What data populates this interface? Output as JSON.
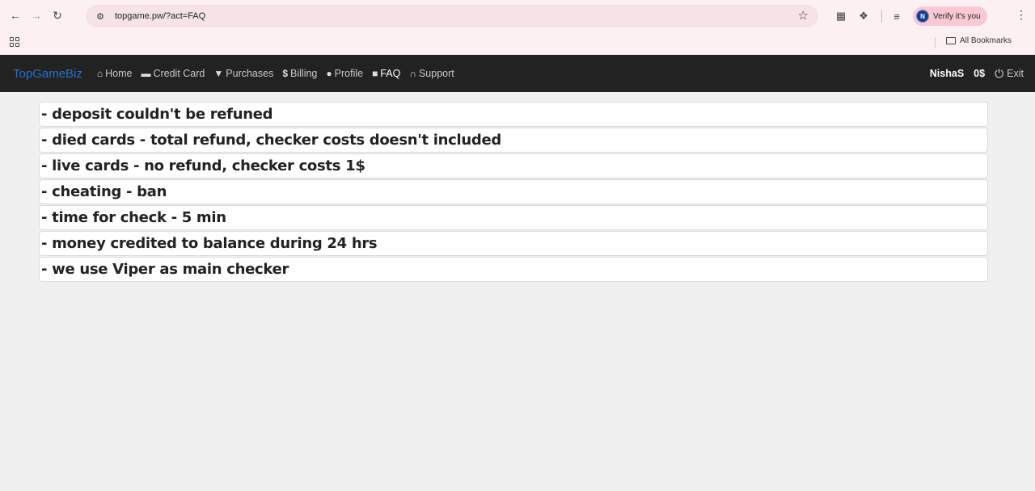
{
  "browser": {
    "url": "topgame.pw/?act=FAQ",
    "profile_label": "Verify it's you",
    "profile_initial": "N",
    "all_bookmarks": "All Bookmarks"
  },
  "navbar": {
    "brand": "TopGameBiz",
    "items": [
      {
        "label": "Home",
        "icon": "home-icon"
      },
      {
        "label": "Credit Card",
        "icon": "credit-card-icon"
      },
      {
        "label": "Purchases",
        "icon": "cart-icon"
      },
      {
        "label": "Billing",
        "icon": "dollar-icon"
      },
      {
        "label": "Profile",
        "icon": "user-icon"
      },
      {
        "label": "FAQ",
        "icon": "book-icon"
      },
      {
        "label": "Support",
        "icon": "headphones-icon"
      }
    ],
    "username": "NishaS",
    "balance": "0$",
    "exit": "Exit"
  },
  "faq": [
    "- deposit couldn't be refuned",
    "- died cards - total refund, checker costs doesn't included",
    "- live cards - no refund, checker costs 1$",
    "- cheating - ban",
    "- time for check - 5 min",
    "- money credited to balance during 24 hrs",
    "- we use Viper as main checker"
  ]
}
